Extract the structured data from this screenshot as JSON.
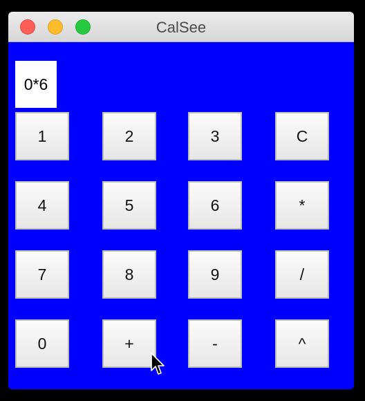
{
  "window": {
    "title": "CalSee"
  },
  "display": {
    "value": "0*6"
  },
  "keys": {
    "k1": "1",
    "k2": "2",
    "k3": "3",
    "clear": "C",
    "k4": "4",
    "k5": "5",
    "k6": "6",
    "multiply": "*",
    "k7": "7",
    "k8": "8",
    "k9": "9",
    "divide": "/",
    "k0": "0",
    "plus": "+",
    "minus": "-",
    "power": "^"
  },
  "colors": {
    "background": "#0000ff",
    "display_background": "#ffffff"
  },
  "icons": {
    "cursor": "mouse-pointer-icon"
  }
}
